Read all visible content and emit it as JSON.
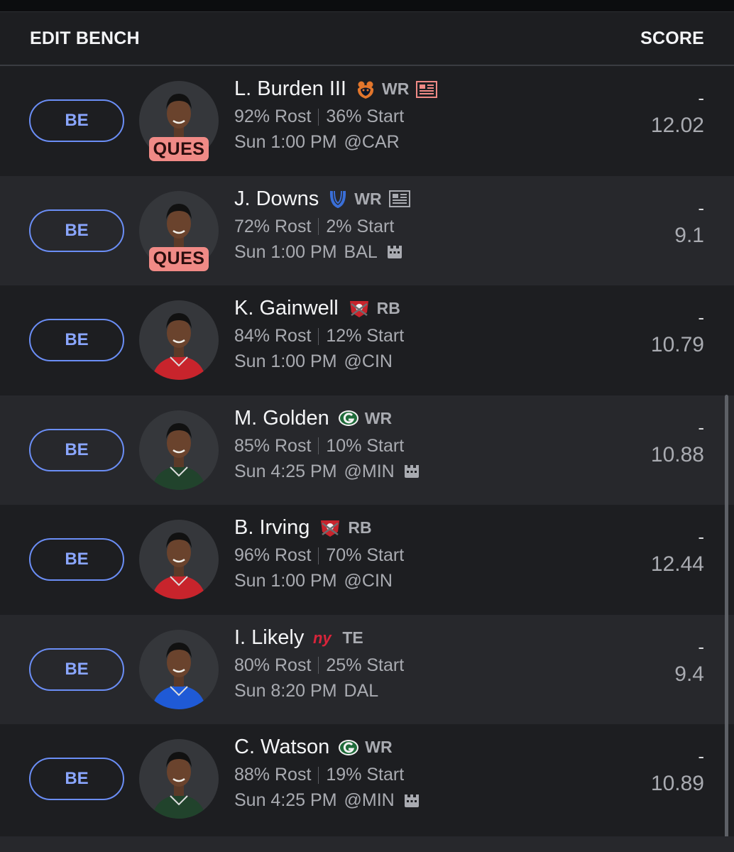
{
  "header": {
    "left": "EDIT BENCH",
    "right": "SCORE"
  },
  "colors": {
    "accent": "#6b8ef6",
    "ques_badge": "#f08a86",
    "bg": "#1d1e21"
  },
  "players": [
    {
      "slot": "BE",
      "name": "L. Burden III",
      "team_logo": "bears-logo-icon",
      "position": "WR",
      "news": true,
      "status": "QUES",
      "rost": "92% Rost",
      "start": "36% Start",
      "day_time": "Sun 1:00 PM",
      "opponent": "@CAR",
      "weather": false,
      "score_actual": "-",
      "score_proj": "12.02",
      "jersey": "#1a1a1a"
    },
    {
      "slot": "BE",
      "name": "J. Downs",
      "team_logo": "colts-logo-icon",
      "position": "WR",
      "news": true,
      "status": "QUES",
      "rost": "72% Rost",
      "start": "2% Start",
      "day_time": "Sun 1:00 PM",
      "opponent": "BAL",
      "weather": true,
      "score_actual": "-",
      "score_proj": "9.1",
      "jersey": "#1a1a1a"
    },
    {
      "slot": "BE",
      "name": "K. Gainwell",
      "team_logo": "buccaneers-logo-icon",
      "position": "RB",
      "news": false,
      "status": "",
      "rost": "84% Rost",
      "start": "12% Start",
      "day_time": "Sun 1:00 PM",
      "opponent": "@CIN",
      "weather": false,
      "score_actual": "-",
      "score_proj": "10.79",
      "jersey": "#c8242c"
    },
    {
      "slot": "BE",
      "name": "M. Golden",
      "team_logo": "packers-logo-icon",
      "position": "WR",
      "news": false,
      "status": "",
      "rost": "85% Rost",
      "start": "10% Start",
      "day_time": "Sun 4:25 PM",
      "opponent": "@MIN",
      "weather": true,
      "score_actual": "-",
      "score_proj": "10.88",
      "jersey": "#21432c"
    },
    {
      "slot": "BE",
      "name": "B. Irving",
      "team_logo": "buccaneers-logo-icon",
      "position": "RB",
      "news": false,
      "status": "",
      "rost": "96% Rost",
      "start": "70% Start",
      "day_time": "Sun 1:00 PM",
      "opponent": "@CIN",
      "weather": false,
      "score_actual": "-",
      "score_proj": "12.44",
      "jersey": "#c8242c"
    },
    {
      "slot": "BE",
      "name": "I. Likely",
      "team_logo": "giants-logo-icon",
      "position": "TE",
      "news": false,
      "status": "",
      "rost": "80% Rost",
      "start": "25% Start",
      "day_time": "Sun 8:20 PM",
      "opponent": "DAL",
      "weather": false,
      "score_actual": "-",
      "score_proj": "9.4",
      "jersey": "#1f5ad6"
    },
    {
      "slot": "BE",
      "name": "C. Watson",
      "team_logo": "packers-logo-icon",
      "position": "WR",
      "news": false,
      "status": "",
      "rost": "88% Rost",
      "start": "19% Start",
      "day_time": "Sun 4:25 PM",
      "opponent": "@MIN",
      "weather": true,
      "score_actual": "-",
      "score_proj": "10.89",
      "jersey": "#21432c"
    }
  ]
}
